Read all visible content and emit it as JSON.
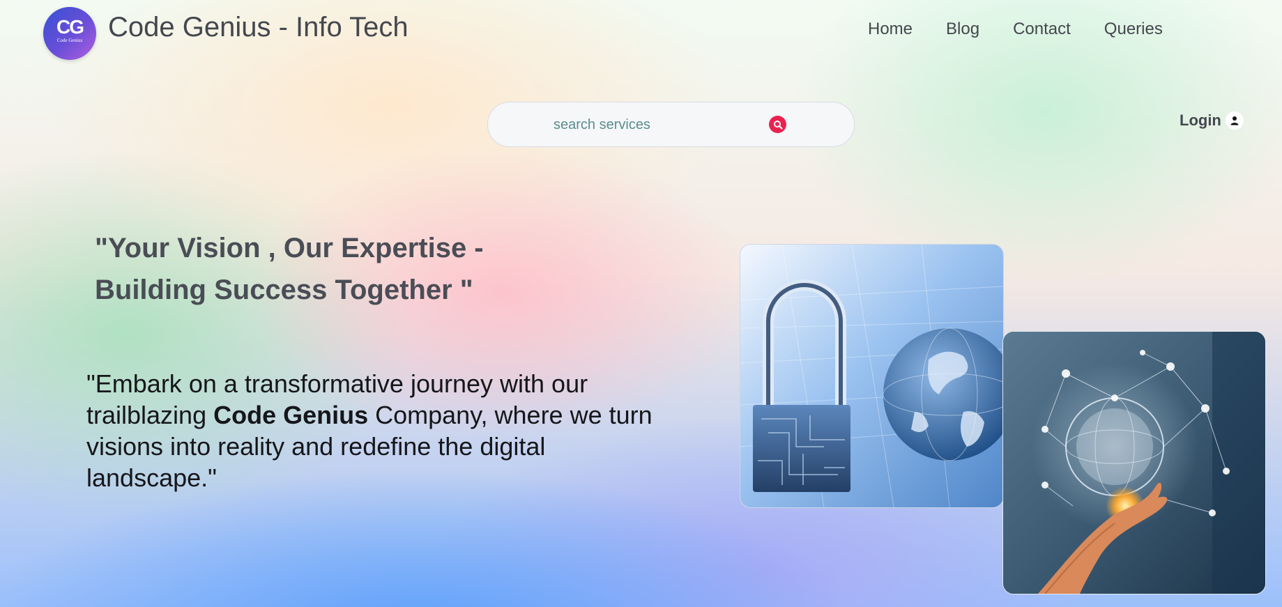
{
  "header": {
    "logo": {
      "mark": "CG",
      "sub": "Code Genius"
    },
    "brand": "Code Genius - Info Tech",
    "nav": [
      {
        "label": "Home"
      },
      {
        "label": "Blog"
      },
      {
        "label": "Contact"
      },
      {
        "label": "Queries"
      }
    ]
  },
  "search": {
    "placeholder": "search services",
    "icon": "search-icon",
    "button_color": "#e8234f"
  },
  "login": {
    "label": "Login",
    "icon": "user-icon"
  },
  "hero": {
    "tagline": "\"Your Vision , Our Expertise - Building Success Together \"",
    "description_start": "\"Embark on a transformative journey with our trailblazing ",
    "description_bold": "Code Genius",
    "description_end": " Company, where we turn visions into reality and redefine the digital landscape.\""
  },
  "images": [
    {
      "name": "padlock-globe-image"
    },
    {
      "name": "hand-holding-network-globe-image"
    }
  ],
  "colors": {
    "text": "#44474e",
    "accent": "#e8234f",
    "logo_gradient_start": "#3650d4",
    "logo_gradient_end": "#b25fe0"
  }
}
